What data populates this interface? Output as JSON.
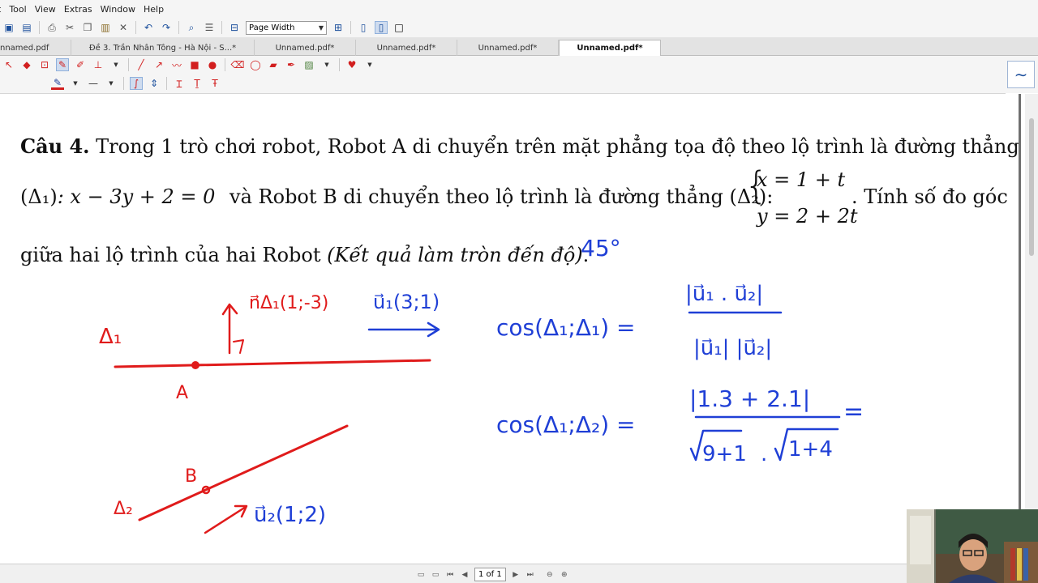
{
  "menu": {
    "items": [
      "t",
      "Tool",
      "View",
      "Extras",
      "Window",
      "Help"
    ]
  },
  "toolbar": {
    "zoom_value": "Page Width"
  },
  "tabs": [
    {
      "label": "nnamed.pdf",
      "active": false
    },
    {
      "label": "Đề 3. Trần Nhân Tông - Hà Nội - S...*",
      "active": false
    },
    {
      "label": "Unnamed.pdf*",
      "active": false
    },
    {
      "label": "Unnamed.pdf*",
      "active": false
    },
    {
      "label": "Unnamed.pdf*",
      "active": false
    },
    {
      "label": "Unnamed.pdf*",
      "active": true
    }
  ],
  "document": {
    "heading": "Câu 4.",
    "line1": "Trong 1 trò chơi robot, Robot A di chuyển trên mặt phẳng tọa độ theo lộ trình là đường thẳng",
    "delta1_label": "(Δ₁)",
    "delta1_eq": ": x − 3y + 2 = 0",
    "line2_mid": "và Robot B di chuyển theo lộ trình là đường thẳng",
    "delta2_label": "(Δ₂):",
    "sys_x": "x = 1 + t",
    "sys_y": "y = 2 + 2t",
    "line2_end": ". Tính số đo góc",
    "line3_start": "giữa hai lộ trình của hai Robot",
    "line3_italic": "(Kết quả làm tròn đến độ)",
    "line3_end": "."
  },
  "handwriting": {
    "answer": "45°",
    "delta1": "Δ₁",
    "point_a": "A",
    "normal": "n⃗Δ₁(1;-3)",
    "u1": "u⃗₁(3;1)",
    "delta2": "Δ₂",
    "point_b": "B",
    "u2": "u⃗₂(1;2)",
    "cos_lhs1": "cos(Δ₁;Δ₁) =",
    "frac1_num": "|u⃗₁ . u⃗₂|",
    "frac1_den": "|u⃗₁| |u⃗₂|",
    "cos_lhs2": "cos(Δ₁;Δ₂) =",
    "frac2_num": "|1.3 + 2.1|",
    "frac2_den_a": "9+1",
    "frac2_den_b": "1+4",
    "eq_tail": "="
  },
  "statusbar": {
    "page_indicator": "1 of 1"
  },
  "colors": {
    "ink_red": "#e01b1b",
    "ink_blue": "#1f3fd6",
    "accent": "#1c4f9c"
  },
  "icons": [
    "save-icon",
    "print-icon",
    "cut-icon",
    "copy-icon",
    "paste-icon",
    "close-icon",
    "undo-icon",
    "redo-icon",
    "find-icon",
    "hand-tool-icon",
    "select-icon",
    "pen-icon",
    "line-icon",
    "arrow-icon",
    "rectangle-icon",
    "ellipse-icon",
    "eraser-icon",
    "lasso-icon",
    "highlighter-icon",
    "stamp-icon",
    "heart-icon",
    "text-color-icon",
    "line-style-icon"
  ]
}
